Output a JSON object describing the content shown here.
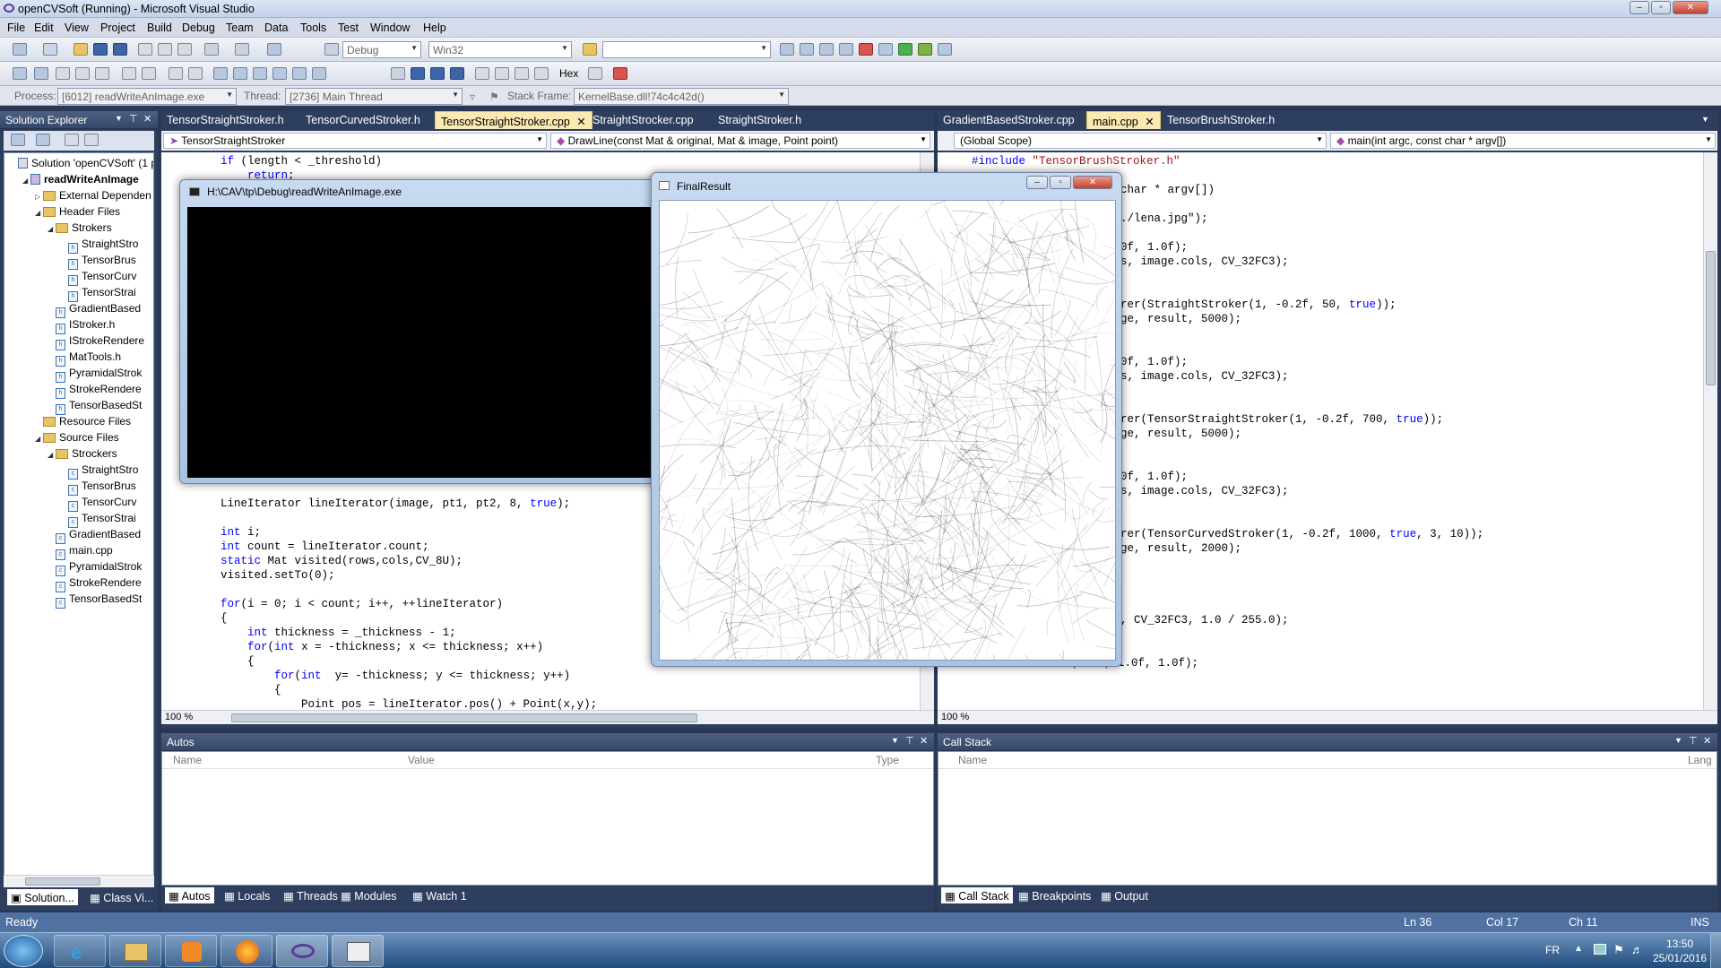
{
  "window": {
    "title": "openCVSoft (Running) - Microsoft Visual Studio"
  },
  "menu": [
    "File",
    "Edit",
    "View",
    "Project",
    "Build",
    "Debug",
    "Team",
    "Data",
    "Tools",
    "Test",
    "Window",
    "Help"
  ],
  "toolbar": {
    "config": "Debug",
    "platform": "Win32",
    "hex_label": "Hex"
  },
  "debugbar": {
    "process_label": "Process:",
    "process_value": "[6012] readWriteAnImage.exe",
    "thread_label": "Thread:",
    "thread_value": "[2736] Main Thread",
    "stack_label": "Stack Frame:",
    "stack_value": "KernelBase.dll!74c4c42d()"
  },
  "solution_explorer": {
    "title": "Solution Explorer",
    "items": [
      {
        "label": "Solution 'openCVSoft' (1 p",
        "indent": 0,
        "kind": "sol"
      },
      {
        "label": "readWriteAnImage",
        "indent": 1,
        "kind": "proj"
      },
      {
        "label": "External Dependen",
        "indent": 2,
        "kind": "folder"
      },
      {
        "label": "Header Files",
        "indent": 2,
        "kind": "folder"
      },
      {
        "label": "Strokers",
        "indent": 3,
        "kind": "folder"
      },
      {
        "label": "StraightStro",
        "indent": 4,
        "kind": "h"
      },
      {
        "label": "TensorBrus",
        "indent": 4,
        "kind": "h"
      },
      {
        "label": "TensorCurv",
        "indent": 4,
        "kind": "h"
      },
      {
        "label": "TensorStrai",
        "indent": 4,
        "kind": "h"
      },
      {
        "label": "GradientBased",
        "indent": 3,
        "kind": "h"
      },
      {
        "label": "IStroker.h",
        "indent": 3,
        "kind": "h"
      },
      {
        "label": "IStrokeRendere",
        "indent": 3,
        "kind": "h"
      },
      {
        "label": "MatTools.h",
        "indent": 3,
        "kind": "h"
      },
      {
        "label": "PyramidalStrok",
        "indent": 3,
        "kind": "h"
      },
      {
        "label": "StrokeRendere",
        "indent": 3,
        "kind": "h"
      },
      {
        "label": "TensorBasedSt",
        "indent": 3,
        "kind": "h"
      },
      {
        "label": "Resource Files",
        "indent": 2,
        "kind": "folder"
      },
      {
        "label": "Source Files",
        "indent": 2,
        "kind": "folder"
      },
      {
        "label": "Strockers",
        "indent": 3,
        "kind": "folder"
      },
      {
        "label": "StraightStro",
        "indent": 4,
        "kind": "cpp"
      },
      {
        "label": "TensorBrus",
        "indent": 4,
        "kind": "cpp"
      },
      {
        "label": "TensorCurv",
        "indent": 4,
        "kind": "cpp"
      },
      {
        "label": "TensorStrai",
        "indent": 4,
        "kind": "cpp"
      },
      {
        "label": "GradientBased",
        "indent": 3,
        "kind": "cpp"
      },
      {
        "label": "main.cpp",
        "indent": 3,
        "kind": "cpp"
      },
      {
        "label": "PyramidalStrok",
        "indent": 3,
        "kind": "cpp"
      },
      {
        "label": "StrokeRendere",
        "indent": 3,
        "kind": "cpp"
      },
      {
        "label": "TensorBasedSt",
        "indent": 3,
        "kind": "cpp"
      }
    ],
    "bottom_tabs": [
      "Solution...",
      "Class Vi..."
    ]
  },
  "left_editor": {
    "tabs": [
      "TensorStraightStroker.h",
      "TensorCurvedStroker.h",
      "TensorStraightStroker.cpp",
      "StraightStrocker.cpp",
      "StraightStroker.h"
    ],
    "active_tab": 2,
    "scope": "TensorStraightStroker",
    "member": "DrawLine(const Mat & original, Mat & image, Point point)",
    "zoom": "100 %",
    "lines_top": [
      {
        "t": "if (length < _threshold)",
        "i": 0
      },
      {
        "t": "    return;",
        "i": 0
      }
    ],
    "lines": [
      {
        "t": "LineIterator lineIterator(image, pt1, pt2, 8, true);"
      },
      {
        "t": ""
      },
      {
        "t": "int i;"
      },
      {
        "t": "int count = lineIterator.count;"
      },
      {
        "t": "static Mat visited(rows,cols,CV_8U);"
      },
      {
        "t": "visited.setTo(0);"
      },
      {
        "t": ""
      },
      {
        "t": "for(i = 0; i < count; i++, ++lineIterator)"
      },
      {
        "t": "{"
      },
      {
        "t": "    int thickness = _thickness - 1;"
      },
      {
        "t": "    for(int x = -thickness; x <= thickness; x++)"
      },
      {
        "t": "    {"
      },
      {
        "t": "        for(int  y= -thickness; y <= thickness; y++)"
      },
      {
        "t": "        {"
      },
      {
        "t": "            Point pos = lineIterator.pos() + Point(x,y);"
      }
    ]
  },
  "right_editor": {
    "tabs": [
      "GradientBasedStroker.cpp",
      "main.cpp",
      "TensorBrushStroker.h"
    ],
    "active_tab": 1,
    "scope": "(Global Scope)",
    "member": "main(int argc, const char * argv[])",
    "zoom": "100 %",
    "lines": [
      "#include \"TensorBrushStroker.h\"",
      "",
      "char * argv[])",
      "",
      "./lena.jpg\");",
      "",
      "0f, 1.0f);",
      "s, image.cols, CV_32FC3);",
      "",
      "",
      "rer(StraightStroker(1, -0.2f, 50, true));",
      "ge, result, 5000);",
      "",
      "",
      "0f, 1.0f);",
      "s, image.cols, CV_32FC3);",
      "",
      "",
      "rer(TensorStraightStroker(1, -0.2f, 700, true));",
      "ge, result, 5000);",
      "",
      "",
      "0f, 1.0f);",
      "s, image.cols, CV_32FC3);",
      "",
      "",
      "rer(TensorCurvedStroker(1, -0.2f, 1000, true, 3, 10));",
      "ge, result, 2000);",
      "",
      "",
      "",
      "",
      ", CV_32FC3, 1.0 / 255.0);",
      "",
      "int levels = 3;",
      "Vec3f color(1.0f, 1.0f, 1.0f);"
    ]
  },
  "console": {
    "title": "H:\\CAV\\tp\\Debug\\readWriteAnImage.exe"
  },
  "final_result": {
    "title": "FinalResult"
  },
  "autos": {
    "title": "Autos",
    "columns": [
      "Name",
      "Value",
      "Type"
    ],
    "tabs": [
      "Autos",
      "Locals",
      "Threads",
      "Modules",
      "Watch 1"
    ]
  },
  "callstack": {
    "title": "Call Stack",
    "columns": [
      "Name",
      "Lang"
    ],
    "tabs": [
      "Call Stack",
      "Breakpoints",
      "Output"
    ]
  },
  "status": {
    "ready": "Ready",
    "ln": "Ln 36",
    "col": "Col 17",
    "ch": "Ch 11",
    "ins": "INS"
  },
  "taskbar": {
    "lang": "FR",
    "time": "13:50",
    "date": "25/01/2016"
  }
}
